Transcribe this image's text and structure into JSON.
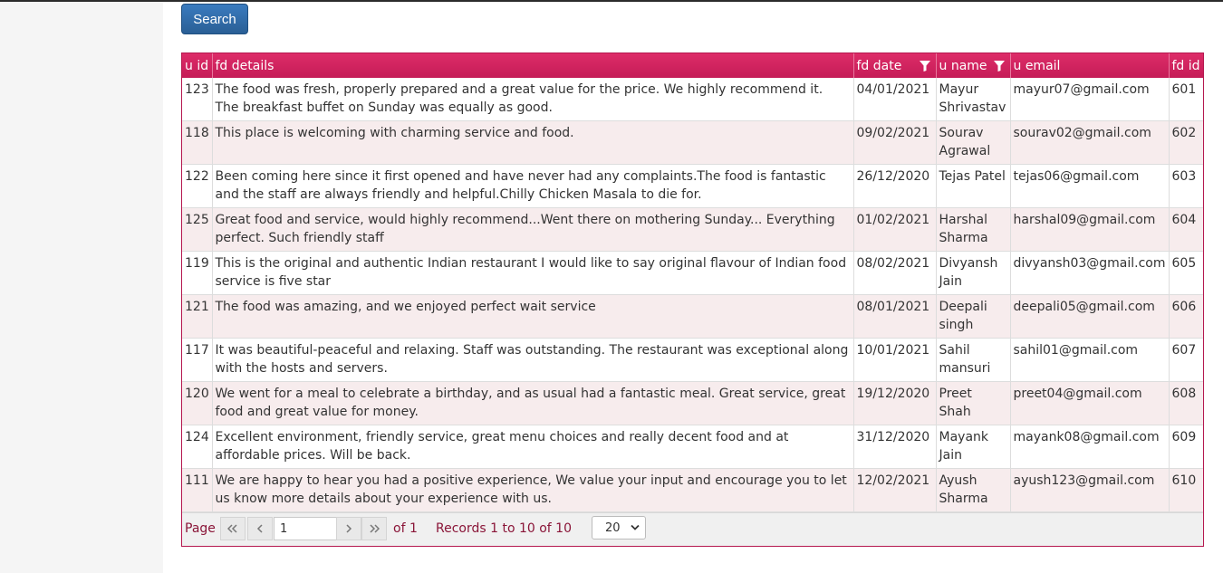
{
  "search_label": "Search",
  "columns": {
    "u_id": "u id",
    "fd_details": "fd details",
    "fd_date": "fd date",
    "u_name": "u name",
    "u_email": "u email",
    "fd_id": "fd id"
  },
  "rows": [
    {
      "u_id": "123",
      "fd_details": "The food was fresh, properly prepared and a great value for the price. We highly recommend it. The breakfast buffet on Sunday was equally as good.",
      "fd_date": "04/01/2021",
      "u_name": "Mayur Shrivastav",
      "u_email": "mayur07@gmail.com",
      "fd_id": "601"
    },
    {
      "u_id": "118",
      "fd_details": "This place is welcoming with charming service and food.",
      "fd_date": "09/02/2021",
      "u_name": "Sourav Agrawal",
      "u_email": "sourav02@gmail.com",
      "fd_id": "602"
    },
    {
      "u_id": "122",
      "fd_details": "Been coming here since it first opened and have never had any complaints.The food is fantastic and the staff are always friendly and helpful.Chilly Chicken Masala to die for.",
      "fd_date": "26/12/2020",
      "u_name": "Tejas Patel",
      "u_email": "tejas06@gmail.com",
      "fd_id": "603"
    },
    {
      "u_id": "125",
      "fd_details": "Great food and service, would highly recommend...Went there on mothering Sunday... Everything perfect. Such friendly staff",
      "fd_date": "01/02/2021",
      "u_name": "Harshal Sharma",
      "u_email": "harshal09@gmail.com",
      "fd_id": "604"
    },
    {
      "u_id": "119",
      "fd_details": "This is the original and authentic Indian restaurant I would like to say original flavour of Indian food service is five star",
      "fd_date": "08/02/2021",
      "u_name": "Divyansh Jain",
      "u_email": "divyansh03@gmail.com",
      "fd_id": "605"
    },
    {
      "u_id": "121",
      "fd_details": "The food was amazing, and we enjoyed perfect wait service",
      "fd_date": "08/01/2021",
      "u_name": "Deepali singh",
      "u_email": "deepali05@gmail.com",
      "fd_id": "606"
    },
    {
      "u_id": "117",
      "fd_details": "It was beautiful-peaceful and relaxing. Staff was outstanding. The restaurant was exceptional along with the hosts and servers.",
      "fd_date": "10/01/2021",
      "u_name": "Sahil mansuri",
      "u_email": "sahil01@gmail.com",
      "fd_id": "607"
    },
    {
      "u_id": "120",
      "fd_details": "We went for a meal to celebrate a birthday, and as usual had a fantastic meal. Great service, great food and great value for money.",
      "fd_date": "19/12/2020",
      "u_name": "Preet Shah",
      "u_email": "preet04@gmail.com",
      "fd_id": "608"
    },
    {
      "u_id": "124",
      "fd_details": "Excellent environment, friendly service, great menu choices and really decent food and at affordable prices. Will be back.",
      "fd_date": "31/12/2020",
      "u_name": "Mayank Jain",
      "u_email": "mayank08@gmail.com",
      "fd_id": "609"
    },
    {
      "u_id": "111",
      "fd_details": "We are happy to hear you had a positive experience, We value your input and encourage you to let us know more details about your experience with us.",
      "fd_date": "12/02/2021",
      "u_name": "Ayush Sharma",
      "u_email": "ayush123@gmail.com",
      "fd_id": "610"
    }
  ],
  "pager": {
    "page_label": "Page",
    "page_value": "1",
    "of_label": "of 1",
    "records_label": "Records 1 to 10 of 10",
    "page_size": "20"
  },
  "colors": {
    "header": "#cf2260",
    "border": "#b5184f",
    "search_button": "#2f6aa5",
    "alt_row": "#f7eced"
  },
  "icons": [
    "filter-icon",
    "first-page-icon",
    "prev-page-icon",
    "next-page-icon",
    "last-page-icon",
    "chevron-down-icon"
  ]
}
